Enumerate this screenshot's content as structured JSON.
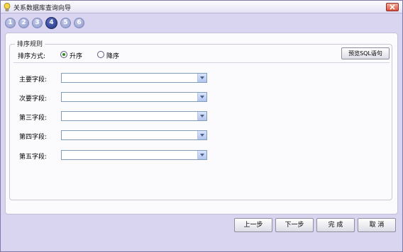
{
  "window": {
    "title": "关系数据库查询向导"
  },
  "steps": [
    "1",
    "2",
    "3",
    "4",
    "5",
    "6"
  ],
  "active_step": "4",
  "sort_rules": {
    "legend": "排序规则",
    "mode_label": "排序方式:",
    "ascending_label": "升序",
    "descending_label": "降序",
    "selected": "升序",
    "preview_button": "预览SQL语句"
  },
  "fields": [
    {
      "label": "主要字段:",
      "value": ""
    },
    {
      "label": "次要字段:",
      "value": ""
    },
    {
      "label": "第三字段:",
      "value": ""
    },
    {
      "label": "第四字段:",
      "value": ""
    },
    {
      "label": "第五字段:",
      "value": ""
    }
  ],
  "buttons": {
    "prev": "上一步",
    "next": "下一步",
    "finish": "完  成",
    "cancel": "取  消"
  }
}
